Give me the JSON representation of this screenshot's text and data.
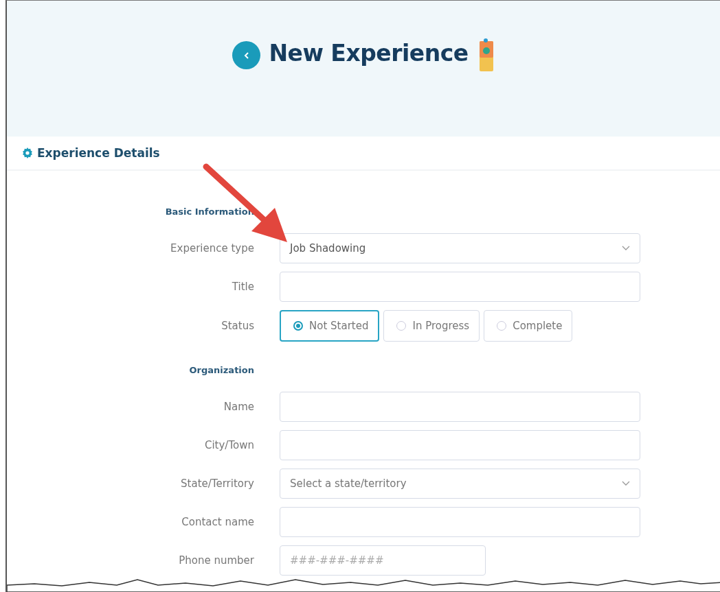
{
  "header": {
    "title": "New Experience"
  },
  "section": {
    "title": "Experience Details"
  },
  "groups": [
    {
      "title": "Basic Information",
      "fields": [
        {
          "kind": "select",
          "label": "Experience type",
          "value": "Job Shadowing"
        },
        {
          "kind": "text",
          "label": "Title"
        },
        {
          "kind": "radio",
          "label": "Status",
          "options": [
            {
              "label": "Not Started",
              "selected": true
            },
            {
              "label": "In Progress",
              "selected": false
            },
            {
              "label": "Complete",
              "selected": false
            }
          ]
        }
      ]
    },
    {
      "title": "Organization",
      "fields": [
        {
          "kind": "text",
          "label": "Name"
        },
        {
          "kind": "text",
          "label": "City/Town"
        },
        {
          "kind": "select",
          "label": "State/Territory",
          "placeholder": "Select a state/territory"
        },
        {
          "kind": "text",
          "label": "Contact name"
        },
        {
          "kind": "phone",
          "label": "Phone number",
          "placeholder": "###-###-####"
        }
      ]
    }
  ]
}
